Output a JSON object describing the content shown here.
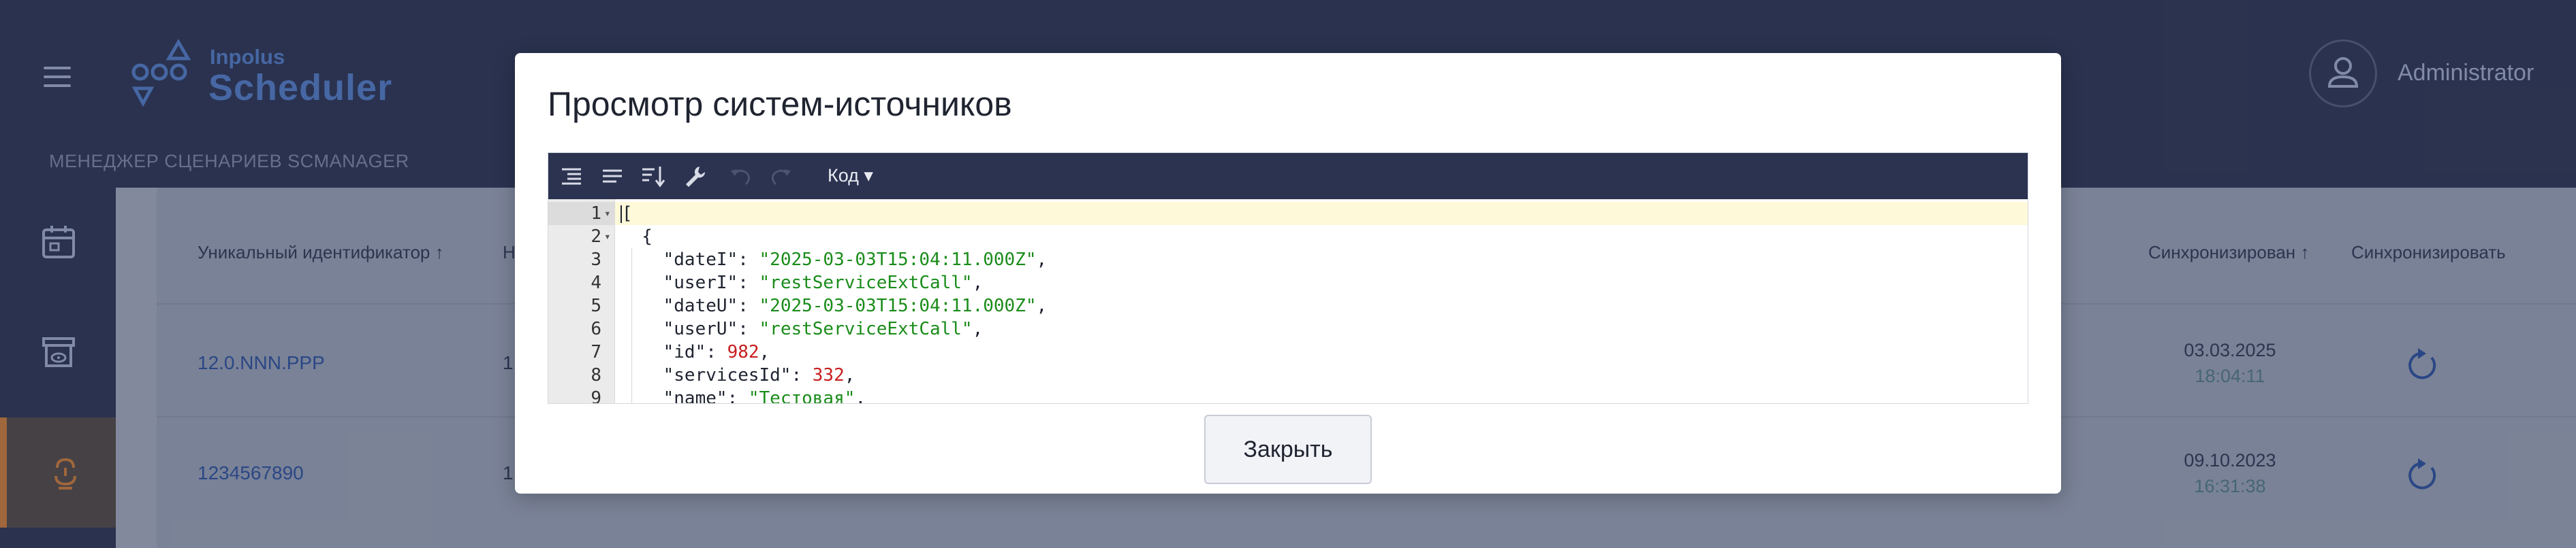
{
  "app": {
    "logo_top": "Inpolus",
    "logo_main": "Scheduler",
    "breadcrumb": "МЕНЕДЖЕР СЦЕНАРИЕВ SCMANAGER",
    "user_name": "Administrator"
  },
  "table": {
    "headers": {
      "id": "Уникальный идентификатор",
      "second": "Н",
      "synced": "Синхронизирован",
      "sync": "Синхронизировать"
    },
    "rows": [
      {
        "id": "12.0.NNN.PPP",
        "second": "1.",
        "date": "03.03.2025",
        "time": "18:04:11"
      },
      {
        "id": "1234567890",
        "second": "1.",
        "date": "09.10.2023",
        "time": "16:31:38"
      }
    ]
  },
  "modal": {
    "title": "Просмотр систем-источников",
    "mode_label": "Код ▾",
    "close_label": "Закрыть",
    "code_lines": [
      {
        "num": "1",
        "fold": "▾",
        "parts": [
          [
            "k",
            "["
          ]
        ]
      },
      {
        "num": "2",
        "fold": "▾",
        "parts": [
          [
            "k",
            "  {"
          ]
        ]
      },
      {
        "num": "3",
        "fold": "",
        "parts": [
          [
            "k",
            "    "
          ],
          [
            "k",
            "\"dateI\""
          ],
          [
            "k",
            ": "
          ],
          [
            "s",
            "\"2025-03-03T15:04:11.000Z\""
          ],
          [
            "k",
            ","
          ]
        ]
      },
      {
        "num": "4",
        "fold": "",
        "parts": [
          [
            "k",
            "    "
          ],
          [
            "k",
            "\"userI\""
          ],
          [
            "k",
            ": "
          ],
          [
            "s",
            "\"restServiceExtCall\""
          ],
          [
            "k",
            ","
          ]
        ]
      },
      {
        "num": "5",
        "fold": "",
        "parts": [
          [
            "k",
            "    "
          ],
          [
            "k",
            "\"dateU\""
          ],
          [
            "k",
            ": "
          ],
          [
            "s",
            "\"2025-03-03T15:04:11.000Z\""
          ],
          [
            "k",
            ","
          ]
        ]
      },
      {
        "num": "6",
        "fold": "",
        "parts": [
          [
            "k",
            "    "
          ],
          [
            "k",
            "\"userU\""
          ],
          [
            "k",
            ": "
          ],
          [
            "s",
            "\"restServiceExtCall\""
          ],
          [
            "k",
            ","
          ]
        ]
      },
      {
        "num": "7",
        "fold": "",
        "parts": [
          [
            "k",
            "    "
          ],
          [
            "k",
            "\"id\""
          ],
          [
            "k",
            ": "
          ],
          [
            "n",
            "982"
          ],
          [
            "k",
            ","
          ]
        ]
      },
      {
        "num": "8",
        "fold": "",
        "parts": [
          [
            "k",
            "    "
          ],
          [
            "k",
            "\"servicesId\""
          ],
          [
            "k",
            ": "
          ],
          [
            "n",
            "332"
          ],
          [
            "k",
            ","
          ]
        ]
      },
      {
        "num": "9",
        "fold": "",
        "parts": [
          [
            "k",
            "    "
          ],
          [
            "k",
            "\"name\""
          ],
          [
            "k",
            ": "
          ],
          [
            "s",
            "\"Тестовая\""
          ],
          [
            "k",
            ","
          ]
        ]
      }
    ]
  },
  "colors": {
    "topbar": "#2b3350",
    "accent": "#4a6fb0",
    "string": "#1a8c1a",
    "number": "#c81e1e"
  }
}
